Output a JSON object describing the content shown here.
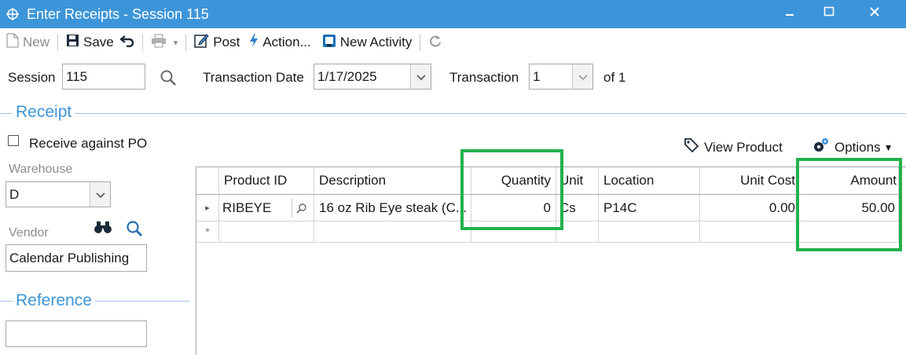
{
  "window": {
    "title": "Enter Receipts - Session 115"
  },
  "toolbar": {
    "new_label": "New",
    "save_label": "Save",
    "post_label": "Post",
    "action_label": "Action...",
    "new_activity_label": "New Activity"
  },
  "header": {
    "session_label": "Session",
    "session_value": "115",
    "transaction_date_label": "Transaction Date",
    "transaction_date_value": "1/17/2025",
    "transaction_label": "Transaction",
    "transaction_value": "1",
    "of_label": "of 1"
  },
  "receipt": {
    "group_title": "Receipt",
    "receive_against_po_label": "Receive against PO",
    "receive_against_po_checked": false,
    "warehouse_label": "Warehouse",
    "warehouse_value": "D",
    "vendor_label": "Vendor",
    "vendor_value": "Calendar Publishing"
  },
  "reference": {
    "group_title": "Reference",
    "value": ""
  },
  "grid_actions": {
    "view_product_label": "View Product",
    "options_label": "Options"
  },
  "grid": {
    "columns": [
      "Product ID",
      "Description",
      "Quantity",
      "Unit",
      "Location",
      "Unit Cost",
      "Amount"
    ],
    "rows": [
      {
        "product_id": "RIBEYE",
        "description": "16 oz Rib Eye steak (C...",
        "quantity": "0",
        "unit": "Cs",
        "location": "P14C",
        "unit_cost": "0.00",
        "amount": "50.00"
      }
    ],
    "new_row_marker": "*",
    "current_row_marker": "▸"
  },
  "colors": {
    "title_bar": "#3d95d9",
    "group_title": "#3d95d9",
    "highlight": "#22b14c"
  }
}
